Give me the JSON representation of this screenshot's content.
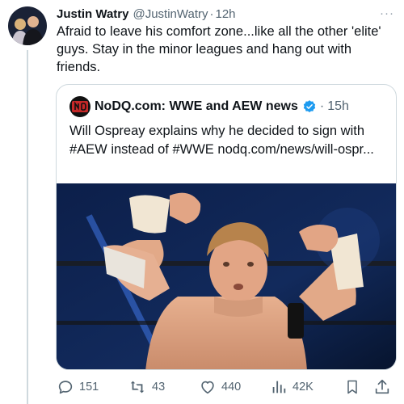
{
  "tweet": {
    "author_name": "Justin Watry",
    "handle": "@JustinWatry",
    "separator": "·",
    "time": "12h",
    "more": "···",
    "text": "Afraid to leave his comfort zone...like all the other 'elite' guys. Stay in the minor leagues and hang out with friends."
  },
  "quote": {
    "author_name": "NoDQ.com: WWE and AEW news",
    "separator": "·",
    "time": "15h",
    "text": "Will Ospreay explains why he decided to sign with #AEW instead of #WWE nodq.com/news/will-ospr..."
  },
  "actions": {
    "replies": "151",
    "reposts": "43",
    "likes": "440",
    "views": "42K"
  },
  "colors": {
    "text_primary": "#0f1419",
    "text_secondary": "#536471",
    "border": "#cfd9de",
    "verified_blue": "#1d9bf0"
  },
  "icons": [
    "avatar",
    "nodq-logo",
    "verified-badge-icon",
    "reply-icon",
    "repost-icon",
    "like-icon",
    "views-icon",
    "bookmark-icon",
    "share-icon"
  ]
}
